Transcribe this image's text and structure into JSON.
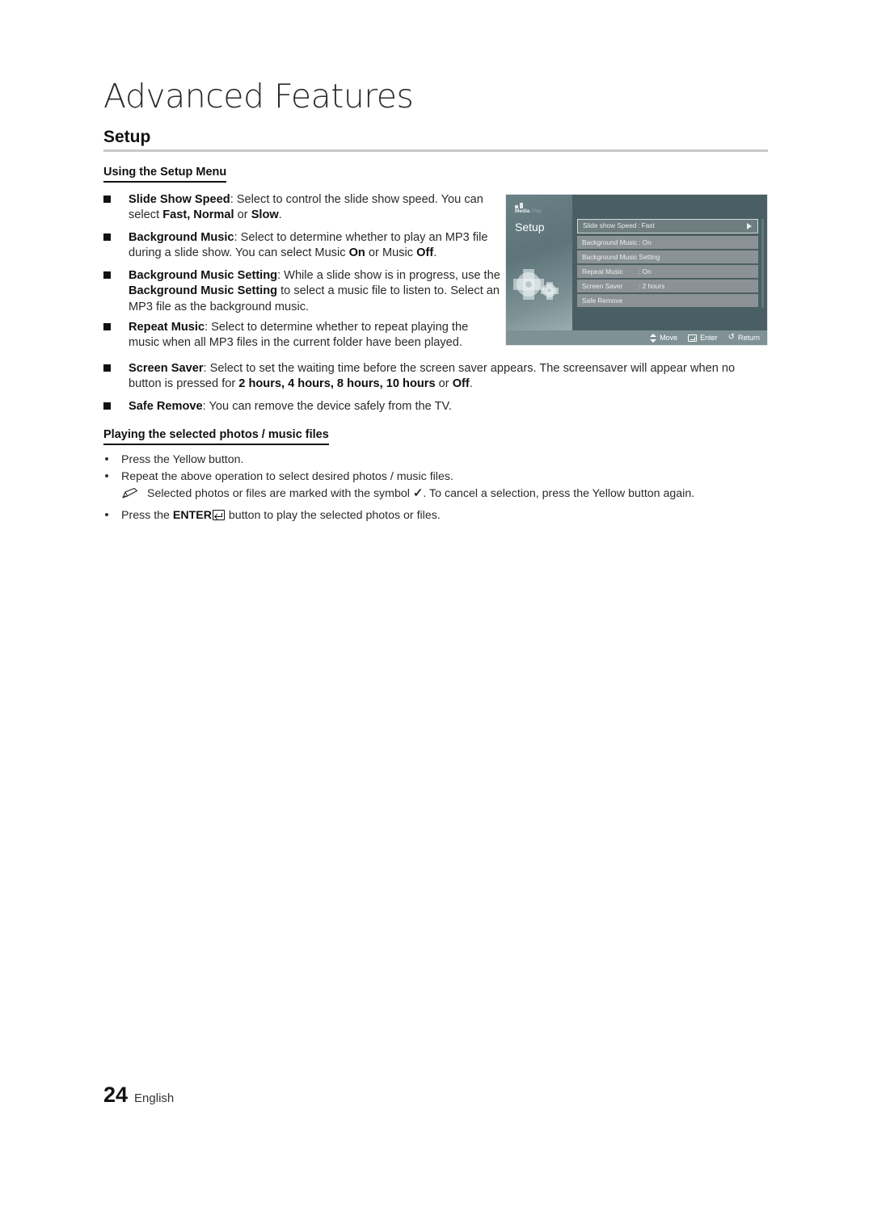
{
  "header": {
    "chapter_title": "Advanced Features",
    "section_title": "Setup"
  },
  "subheads": {
    "using_setup_menu": "Using the Setup Menu",
    "playing_selected": "Playing the selected photos / music files"
  },
  "bullets": [
    {
      "label": "Slide Show Speed",
      "text": ": Select to control the slide show speed. You can select ",
      "bold_tail": "Fast, Normal",
      "mid": " or ",
      "bold_tail2": "Slow",
      "end": "."
    },
    {
      "label": "Background Music",
      "text": ": Select to determine whether to play an MP3 file during a slide show. You can select Music ",
      "bold_tail": "On",
      "mid": " or Music ",
      "bold_tail2": "Off",
      "end": "."
    },
    {
      "label": "Background Music Setting",
      "text": ": While a slide show is in progress, use the ",
      "bold_tail": "Background Music Setting",
      "mid": " to select a music file to listen to. Select an MP3 file as the background music.",
      "bold_tail2": "",
      "end": ""
    },
    {
      "label": "Repeat Music",
      "text": ": Select to determine whether to repeat playing the music when all MP3 files in the current folder have been played.",
      "bold_tail": "",
      "mid": "",
      "bold_tail2": "",
      "end": ""
    },
    {
      "label": "Screen Saver",
      "text": ": Select to set the waiting time before the screen saver appears. The screensaver will appear when no button is pressed for ",
      "bold_tail": "2 hours, 4 hours, 8 hours, 10 hours",
      "mid": " or ",
      "bold_tail2": "Off",
      "end": "."
    },
    {
      "label": "Safe Remove",
      "text": ": You can remove the device safely from the TV.",
      "bold_tail": "",
      "mid": "",
      "bold_tail2": "",
      "end": ""
    }
  ],
  "steps": {
    "step1": "Press the Yellow button.",
    "step2": "Repeat the above operation to select desired photos / music files.",
    "note_pre": "Selected photos or files are marked with the symbol ",
    "note_symbol": "✓",
    "note_post": ". To cancel a selection, press the Yellow button again.",
    "step3_pre": "Press the ",
    "step3_key": "ENTER",
    "step3_post": " button to play the selected photos or files."
  },
  "tv_osd": {
    "logo_primary": "Media",
    "logo_secondary": " Play",
    "panel_title": "Setup",
    "menu_items": [
      {
        "label": "Slide show Speed",
        "value": ": Fast",
        "selected": true
      },
      {
        "label": "Background Music",
        "value": ": On",
        "selected": false
      },
      {
        "label": "Background Music Setting",
        "value": "",
        "selected": false
      },
      {
        "label": "Repeat Music",
        "value": ": On",
        "selected": false
      },
      {
        "label": "Screen Saver",
        "value": ": 2 hours",
        "selected": false
      },
      {
        "label": "Safe Remove",
        "value": "",
        "selected": false
      }
    ],
    "footer_bar": {
      "move": "Move",
      "enter": "Enter",
      "return": "Return",
      "return_glyph": "↺"
    }
  },
  "footer": {
    "page_number": "24",
    "language": "English"
  },
  "colors": {
    "rule": "#c9c9c9",
    "text": "#2a2a2a",
    "osd_left_panel": "#5d7579",
    "osd_right_panel": "#4a5f63",
    "osd_row": "#8b9296",
    "osd_row_selected": "#6e7d7f",
    "osd_bottom_bar": "#7f9195"
  }
}
